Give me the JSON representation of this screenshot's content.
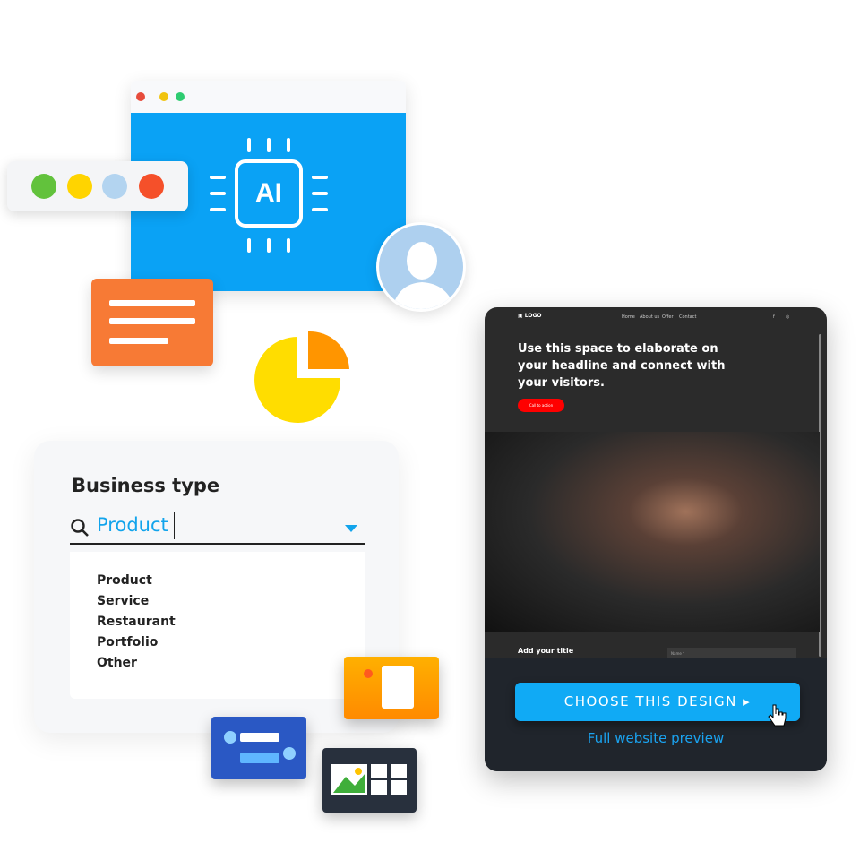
{
  "ai_window": {
    "chip_label": "AI",
    "dot_colors": [
      "#e74c3c",
      "#f1c40f",
      "#2ecc71"
    ],
    "accent": "#0aa2f5"
  },
  "color_palette": [
    "#62c23c",
    "#ffd400",
    "#b3d4f0",
    "#f5502a"
  ],
  "business_type": {
    "title": "Business type",
    "search_value": "Product",
    "options": [
      "Product",
      "Service",
      "Restaurant",
      "Portfolio",
      "Other"
    ]
  },
  "preview": {
    "logo": "LOGO",
    "nav": [
      "Home",
      "About us",
      "Offer",
      "Contact"
    ],
    "headline": "Use this space to elaborate on your headline and connect with your visitors.",
    "cta": "Call to action",
    "section_title": "Add your title",
    "field_placeholder": "Name *",
    "choose_button": "CHOOSE THIS DESIGN",
    "full_preview_link": "Full website preview"
  }
}
